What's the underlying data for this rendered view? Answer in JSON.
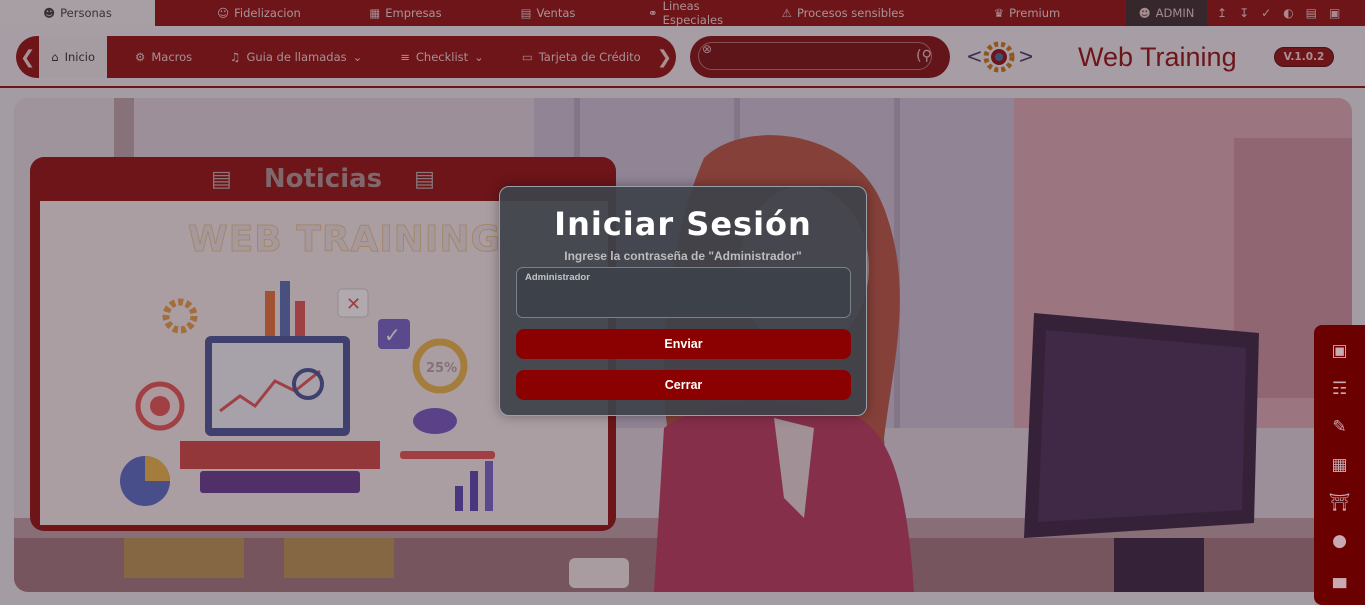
{
  "topbar": {
    "items": [
      {
        "label": "Personas",
        "icon": "user-icon"
      },
      {
        "label": "Fidelizacion",
        "icon": "users-icon"
      },
      {
        "label": "Empresas",
        "icon": "building-icon"
      },
      {
        "label": "Ventas",
        "icon": "money-icon"
      },
      {
        "label": "Lineas Especiales",
        "icon": "microphone-icon"
      },
      {
        "label": "Procesos sensibles",
        "icon": "warning-icon"
      },
      {
        "label": "Premium",
        "icon": "trophy-icon"
      }
    ],
    "admin_label": "ADMIN"
  },
  "navbar": {
    "items": [
      {
        "label": "Inicio",
        "icon": "home-icon"
      },
      {
        "label": "Macros",
        "icon": "gear-icon"
      },
      {
        "label": "Guia de llamadas",
        "icon": "music-note-icon"
      },
      {
        "label": "Checklist",
        "icon": "list-check-icon"
      },
      {
        "label": "Tarjeta de Crédito",
        "icon": "credit-card-icon"
      }
    ],
    "brand": "Web Training",
    "version": "V.1.0.2"
  },
  "news": {
    "title": "Noticias",
    "image_title": "WEB TRAINING"
  },
  "modal": {
    "title": "Iniciar Sesión",
    "subtitle": "Ingrese la contraseña de \"Administrador\"",
    "field_label": "Administrador",
    "field_value": "",
    "send_label": "Enviar",
    "close_label": "Cerrar"
  },
  "colors": {
    "primary": "#8a0000",
    "modal_bg": "#3e424a"
  }
}
